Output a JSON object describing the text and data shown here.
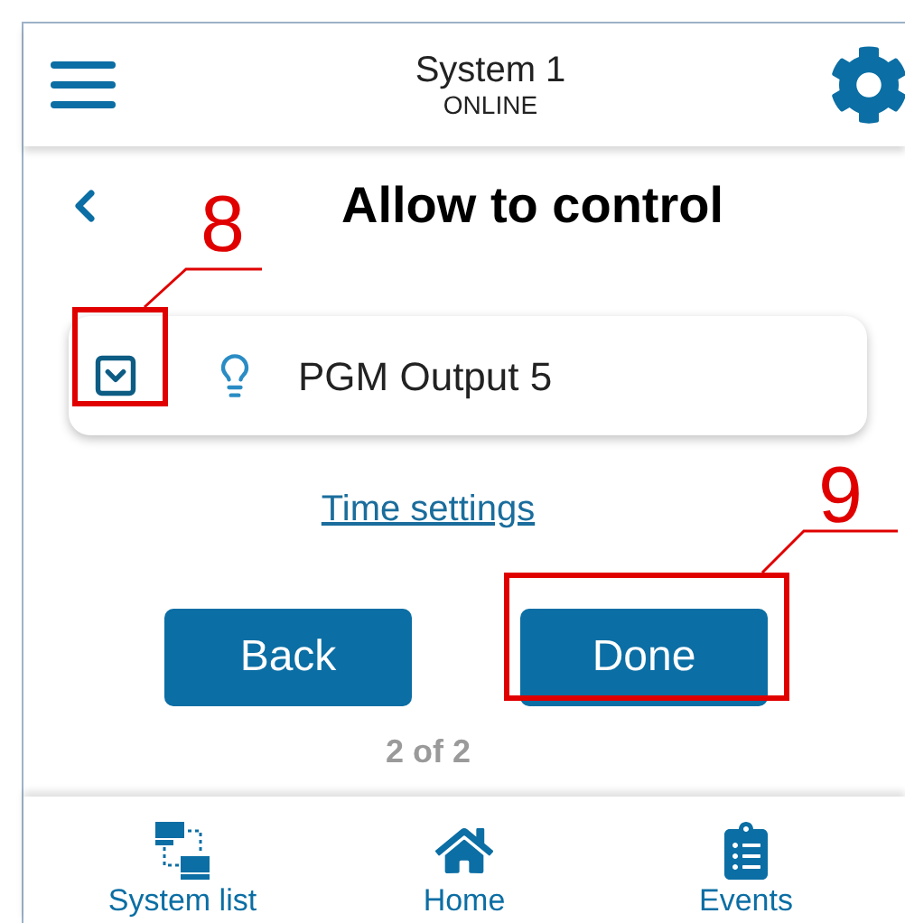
{
  "header": {
    "title": "System 1",
    "status": "ONLINE"
  },
  "page": {
    "title": "Allow to control"
  },
  "outputs": [
    {
      "name": "PGM Output 5",
      "expanded": false
    }
  ],
  "link": "Time settings",
  "buttons": [
    "Back",
    "Done"
  ],
  "pager": "2 of 2",
  "nav": [
    {
      "label": "System list",
      "kind": "systems"
    },
    {
      "label": "Home",
      "kind": "home"
    },
    {
      "label": "Events",
      "kind": "events"
    }
  ],
  "callouts": [
    "8",
    "9"
  ]
}
